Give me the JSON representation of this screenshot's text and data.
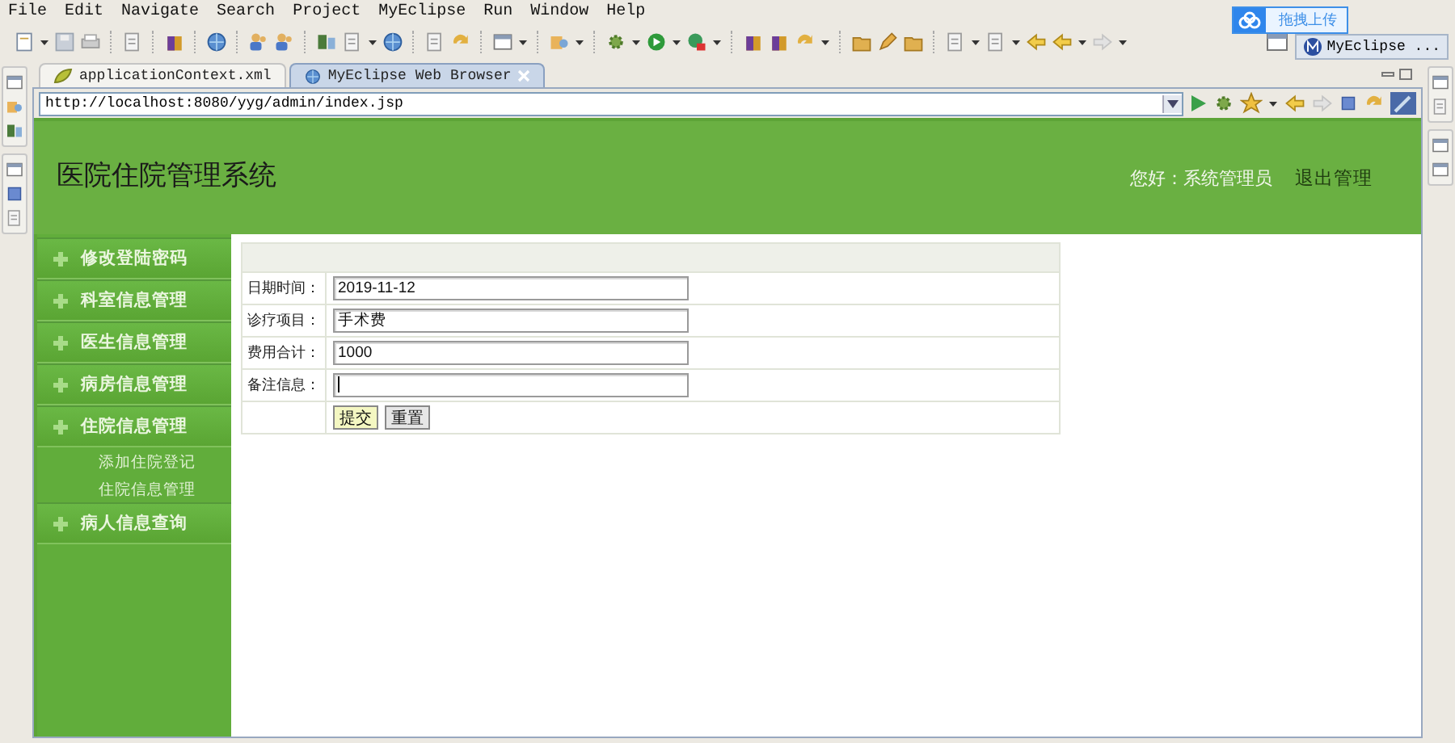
{
  "menu": [
    "File",
    "Edit",
    "Navigate",
    "Search",
    "Project",
    "MyEclipse",
    "Run",
    "Window",
    "Help"
  ],
  "upload_widget": {
    "label": "拖拽上传"
  },
  "perspective": {
    "label": "MyEclipse ..."
  },
  "editor_tabs": [
    {
      "label": "applicationContext.xml",
      "selected": false
    },
    {
      "label": "MyEclipse Web Browser",
      "selected": true
    }
  ],
  "address_bar": {
    "value": "http://localhost:8080/yyg/admin/index.jsp"
  },
  "page": {
    "title": "医院住院管理系统",
    "greeting": "您好：系统管理员",
    "logout": "退出管理",
    "sidebar": [
      {
        "label": "修改登陆密码"
      },
      {
        "label": "科室信息管理"
      },
      {
        "label": "医生信息管理"
      },
      {
        "label": "病房信息管理"
      },
      {
        "label": "住院信息管理",
        "children": [
          {
            "label": "添加住院登记"
          },
          {
            "label": "住院信息管理"
          }
        ]
      },
      {
        "label": "病人信息查询"
      }
    ],
    "form": {
      "rows": [
        {
          "label": "日期时间：",
          "value": "2019-11-12",
          "focused": false
        },
        {
          "label": "诊疗项目：",
          "value": "手术费",
          "focused": false
        },
        {
          "label": "费用合计：",
          "value": "1000",
          "focused": false
        },
        {
          "label": "备注信息：",
          "focused": true
        }
      ],
      "buttons": [
        {
          "label": "提交",
          "kind": "submit"
        },
        {
          "label": "重置",
          "kind": "reset"
        }
      ]
    }
  }
}
